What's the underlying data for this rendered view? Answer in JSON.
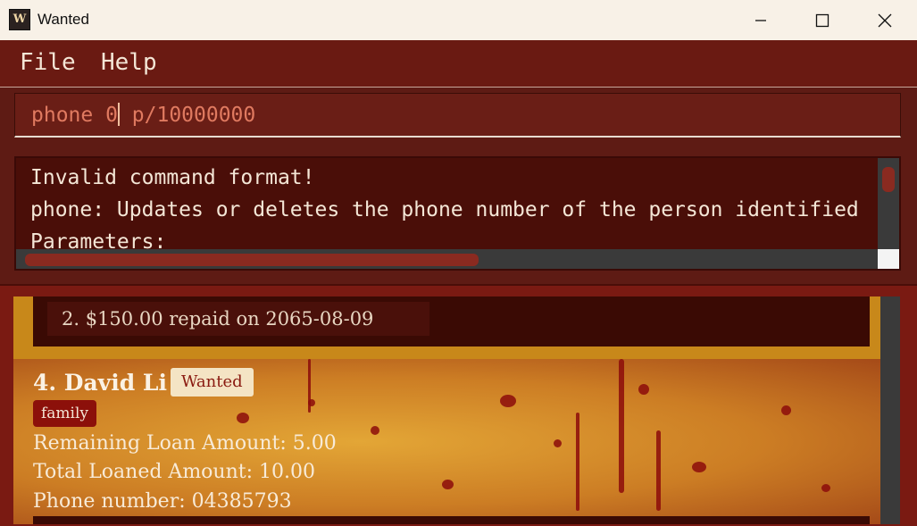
{
  "window": {
    "title": "Wanted",
    "app_icon_text": "W",
    "controls": [
      "minimize-icon",
      "maximize-icon",
      "close-icon"
    ]
  },
  "menu": {
    "file": "File",
    "help": "Help"
  },
  "command": {
    "before_caret": "phone 0",
    "after_caret": " p/10000000"
  },
  "result": {
    "lines": [
      "Invalid command format!",
      "phone: Updates or deletes the phone number of the person identified",
      "Parameters:"
    ]
  },
  "list": {
    "prev_card": {
      "repayment": "2. $150.00 repaid on 2065-08-09"
    },
    "card": {
      "index_name": "4. David Li",
      "badge": "Wanted",
      "tag": "family",
      "remaining": "Remaining Loan Amount: 5.00",
      "total": "Total Loaned Amount: 10.00",
      "phone": "Phone number: 04385793"
    }
  },
  "colors": {
    "menu_bg": "#6a1a12",
    "accent": "#8c100a",
    "card_gold": "#e3a636",
    "command_text": "#e07a60"
  }
}
